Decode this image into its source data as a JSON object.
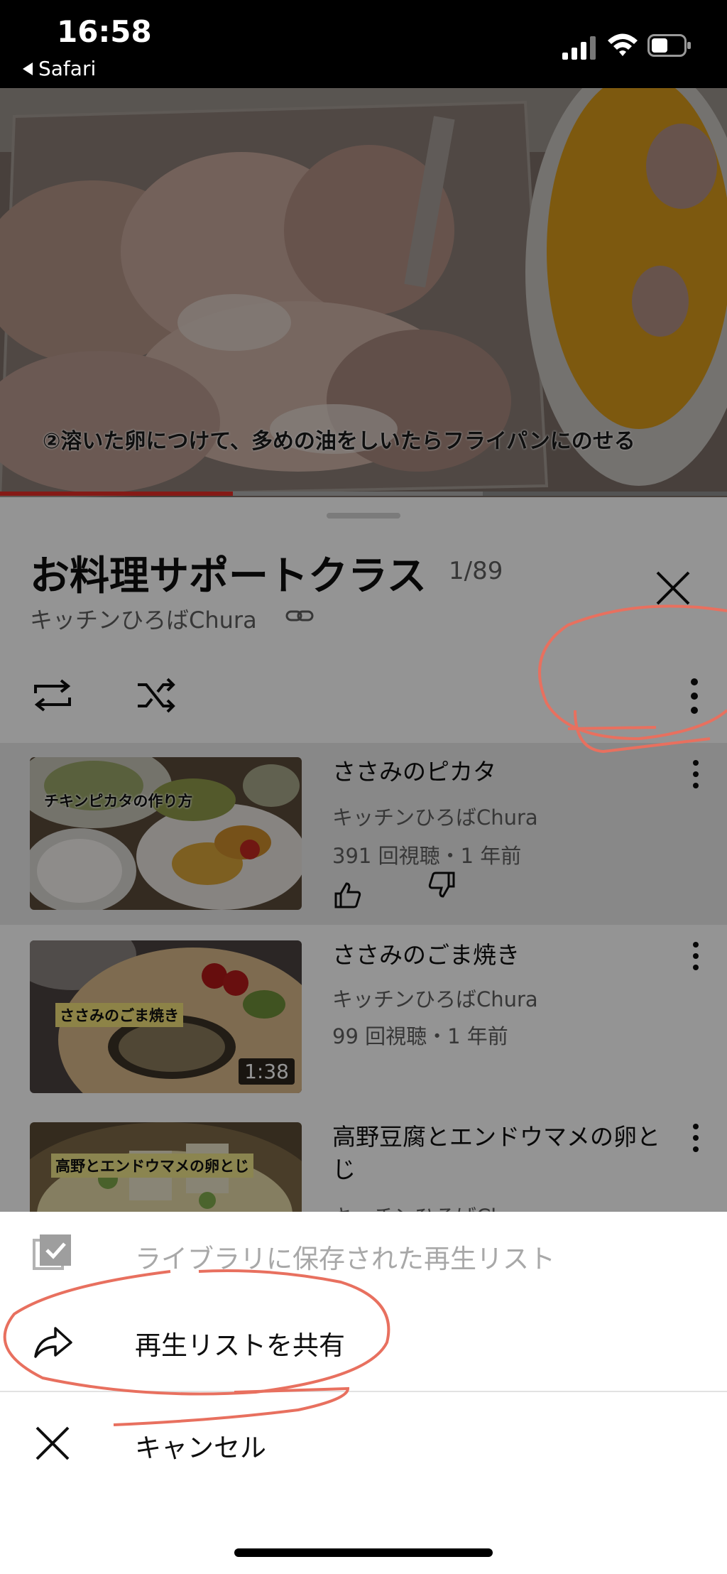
{
  "status_bar": {
    "time": "16:58",
    "back_app": "Safari"
  },
  "video": {
    "caption": "②溶いた卵につけて、多めの油をしいたらフライパンにのせる",
    "progress_fraction": 0.32
  },
  "playlist": {
    "title": "お料理サポートクラス",
    "count": "1/89",
    "channel": "キッチンひろばChura",
    "items": [
      {
        "thumb_label": "チキンピカタの作り方",
        "title": "ささみのピカタ",
        "channel": "キッチンひろばChura",
        "meta": "391 回視聴・1 年前",
        "duration": "",
        "playing": true
      },
      {
        "thumb_label": "ささみのごま焼き",
        "title": "ささみのごま焼き",
        "channel": "キッチンひろばChura",
        "meta": "99 回視聴・1 年前",
        "duration": "1:38",
        "playing": false
      },
      {
        "thumb_label": "高野とエンドウマメの卵とじ",
        "title": "高野豆腐とエンドウマメの卵とじ",
        "channel": "キッチンひろばChura",
        "meta": "",
        "duration": "",
        "playing": false
      }
    ]
  },
  "sheet": {
    "save_label": "ライブラリに保存された再生リスト",
    "share_label": "再生リストを共有",
    "cancel_label": "キャンセル"
  },
  "colors": {
    "progress": "#e52d27",
    "annotation": "#e8705f"
  },
  "icons": [
    "signal-icon",
    "wifi-icon",
    "battery-icon",
    "link-icon",
    "close-icon",
    "repeat-icon",
    "shuffle-icon",
    "more-vertical-icon",
    "thumbs-up-icon",
    "thumbs-down-icon",
    "saved-playlist-icon",
    "share-icon"
  ]
}
